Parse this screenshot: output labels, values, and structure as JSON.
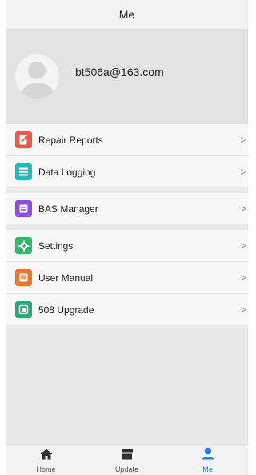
{
  "header": {
    "title": "Me"
  },
  "profile": {
    "email": "bt506a@163.com"
  },
  "menu": {
    "repair_reports": {
      "label": "Repair Reports",
      "icon": "report-icon",
      "color": "#e65a4c"
    },
    "data_logging": {
      "label": "Data Logging",
      "icon": "list-icon",
      "color": "#25b8b8"
    },
    "bas_manager": {
      "label": "BAS Manager",
      "icon": "window-icon",
      "color": "#8a4fd6"
    },
    "settings": {
      "label": "Settings",
      "icon": "gear-icon",
      "color": "#35b56a"
    },
    "user_manual": {
      "label": "User Manual",
      "icon": "book-icon",
      "color": "#e7762e"
    },
    "upgrade_508": {
      "label": "508 Upgrade",
      "icon": "download-icon",
      "color": "#2fa878"
    },
    "chevron": ">"
  },
  "tabbar": {
    "home": {
      "label": "Home",
      "icon": "home-icon"
    },
    "update": {
      "label": "Update",
      "icon": "store-icon"
    },
    "me": {
      "label": "Me",
      "icon": "person-icon"
    },
    "active_color": "#2a7de1"
  }
}
